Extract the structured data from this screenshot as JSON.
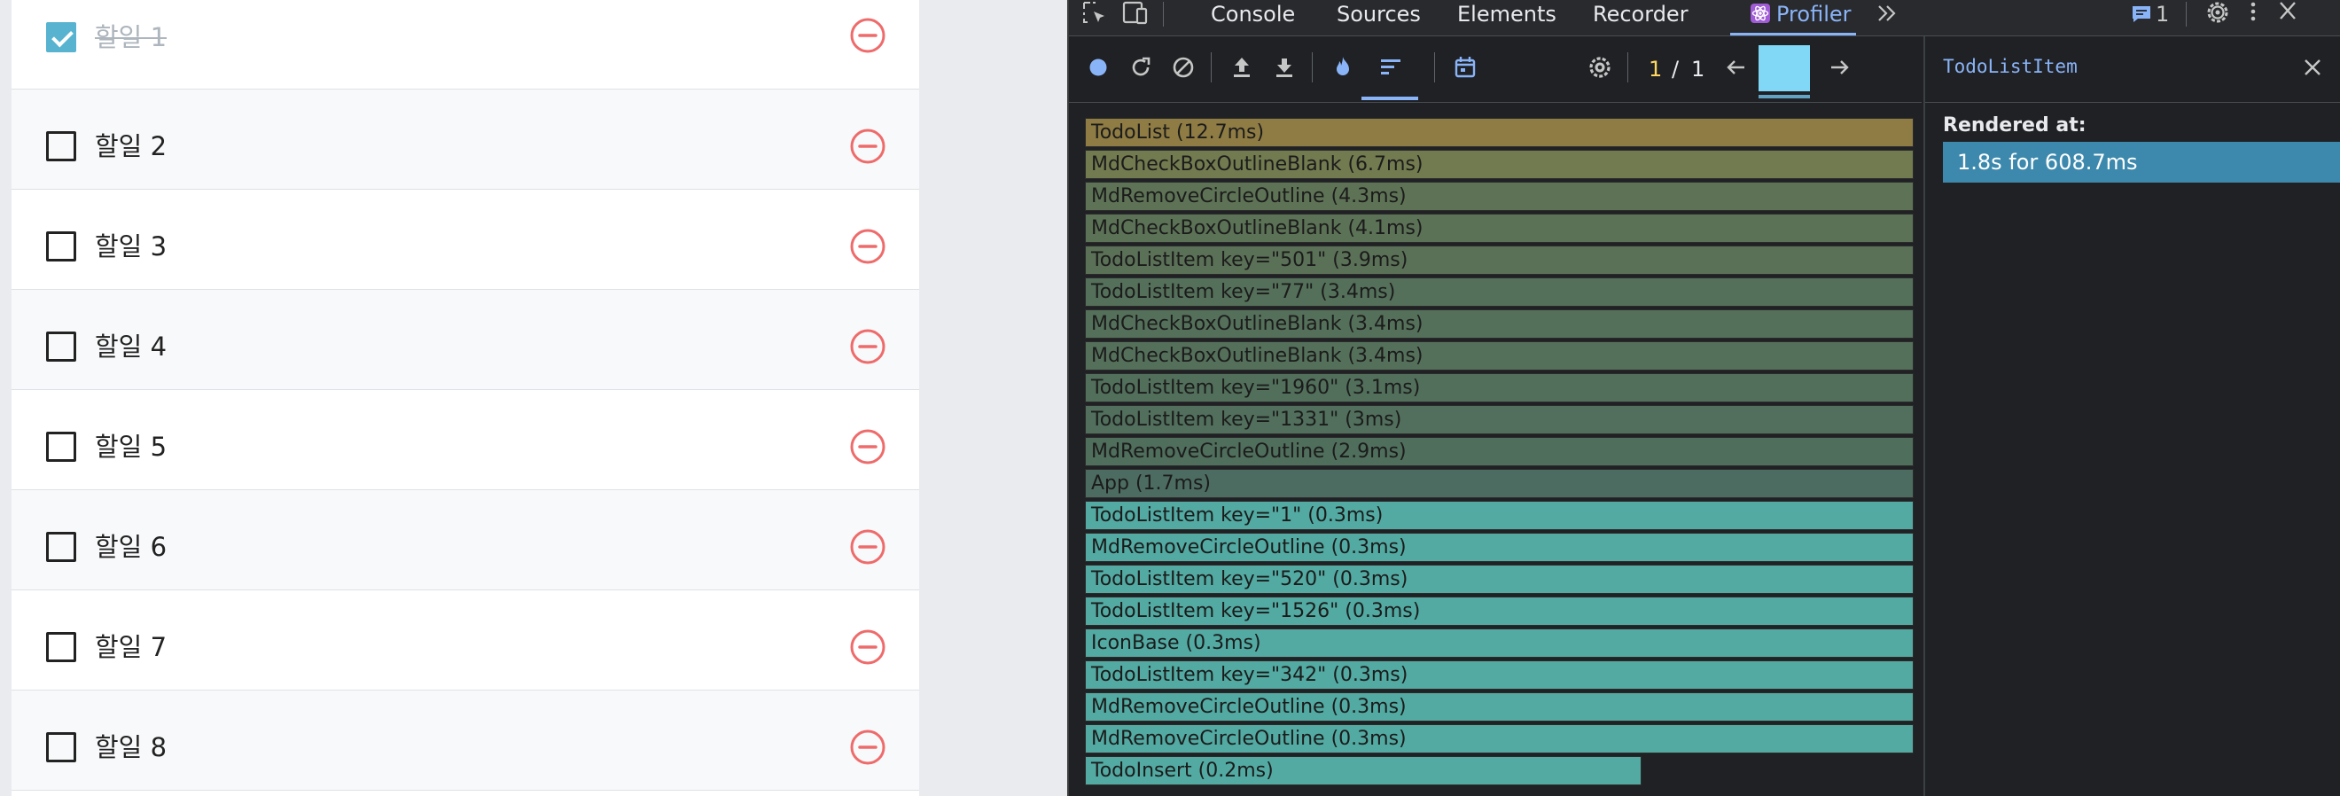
{
  "todo": {
    "items": [
      {
        "text": "할일 1",
        "checked": true
      },
      {
        "text": "할일 2",
        "checked": false
      },
      {
        "text": "할일 3",
        "checked": false
      },
      {
        "text": "할일 4",
        "checked": false
      },
      {
        "text": "할일 5",
        "checked": false
      },
      {
        "text": "할일 6",
        "checked": false
      },
      {
        "text": "할일 7",
        "checked": false
      },
      {
        "text": "할일 8",
        "checked": false
      }
    ],
    "remove_icon": "remove-circle-outline-icon",
    "check_color": "#57b3cf",
    "remove_color": "#ef6b6b"
  },
  "devtools": {
    "tabs": [
      {
        "label": "Console",
        "active": false
      },
      {
        "label": "Sources",
        "active": false
      },
      {
        "label": "Elements",
        "active": false
      },
      {
        "label": "Recorder",
        "active": false
      },
      {
        "label": "Profiler",
        "active": true
      }
    ],
    "issues_count": "1",
    "accent_color": "#8ab4f8",
    "profiler": {
      "commit_current": "1",
      "commit_separator": "/",
      "commit_total": "1"
    },
    "flamegraph": {
      "bars": [
        {
          "label": "TodoList (12.7ms)",
          "color": "#8f7c44",
          "full": true
        },
        {
          "label": "MdCheckBoxOutlineBlank (6.7ms)",
          "color": "#727a4f",
          "full": true
        },
        {
          "label": "MdRemoveCircleOutline (4.3ms)",
          "color": "#5e7356",
          "full": true
        },
        {
          "label": "MdCheckBoxOutlineBlank (4.1ms)",
          "color": "#5c7256",
          "full": true
        },
        {
          "label": "TodoListItem key=\"501\" (3.9ms)",
          "color": "#5b7157",
          "full": true
        },
        {
          "label": "TodoListItem key=\"77\" (3.4ms)",
          "color": "#55705a",
          "full": true
        },
        {
          "label": "MdCheckBoxOutlineBlank (3.4ms)",
          "color": "#55705a",
          "full": true
        },
        {
          "label": "MdCheckBoxOutlineBlank (3.4ms)",
          "color": "#55705a",
          "full": true
        },
        {
          "label": "TodoListItem key=\"1960\" (3.1ms)",
          "color": "#526f5b",
          "full": true
        },
        {
          "label": "TodoListItem key=\"1331\" (3ms)",
          "color": "#516f5c",
          "full": true
        },
        {
          "label": "MdRemoveCircleOutline (2.9ms)",
          "color": "#506e5c",
          "full": true
        },
        {
          "label": "App (1.7ms)",
          "color": "#4d6c61",
          "full": true
        },
        {
          "label": "TodoListItem key=\"1\" (0.3ms)",
          "color": "#52aaa2",
          "full": true
        },
        {
          "label": "MdRemoveCircleOutline (0.3ms)",
          "color": "#52aaa2",
          "full": true
        },
        {
          "label": "TodoListItem key=\"520\" (0.3ms)",
          "color": "#52aaa2",
          "full": true
        },
        {
          "label": "TodoListItem key=\"1526\" (0.3ms)",
          "color": "#52aaa2",
          "full": true
        },
        {
          "label": "IconBase (0.3ms)",
          "color": "#52aaa2",
          "full": true
        },
        {
          "label": "TodoListItem key=\"342\" (0.3ms)",
          "color": "#52aaa2",
          "full": true
        },
        {
          "label": "MdRemoveCircleOutline (0.3ms)",
          "color": "#52aaa2",
          "full": true
        },
        {
          "label": "MdRemoveCircleOutline (0.3ms)",
          "color": "#52aaa2",
          "full": true
        },
        {
          "label": "TodoInsert (0.2ms)",
          "color": "#52aaa2",
          "full": false
        }
      ]
    },
    "side_panel": {
      "title": "TodoListItem",
      "rendered_at_label": "Rendered at:",
      "rendered_at_entry": "1.8s for 608.7ms"
    }
  }
}
